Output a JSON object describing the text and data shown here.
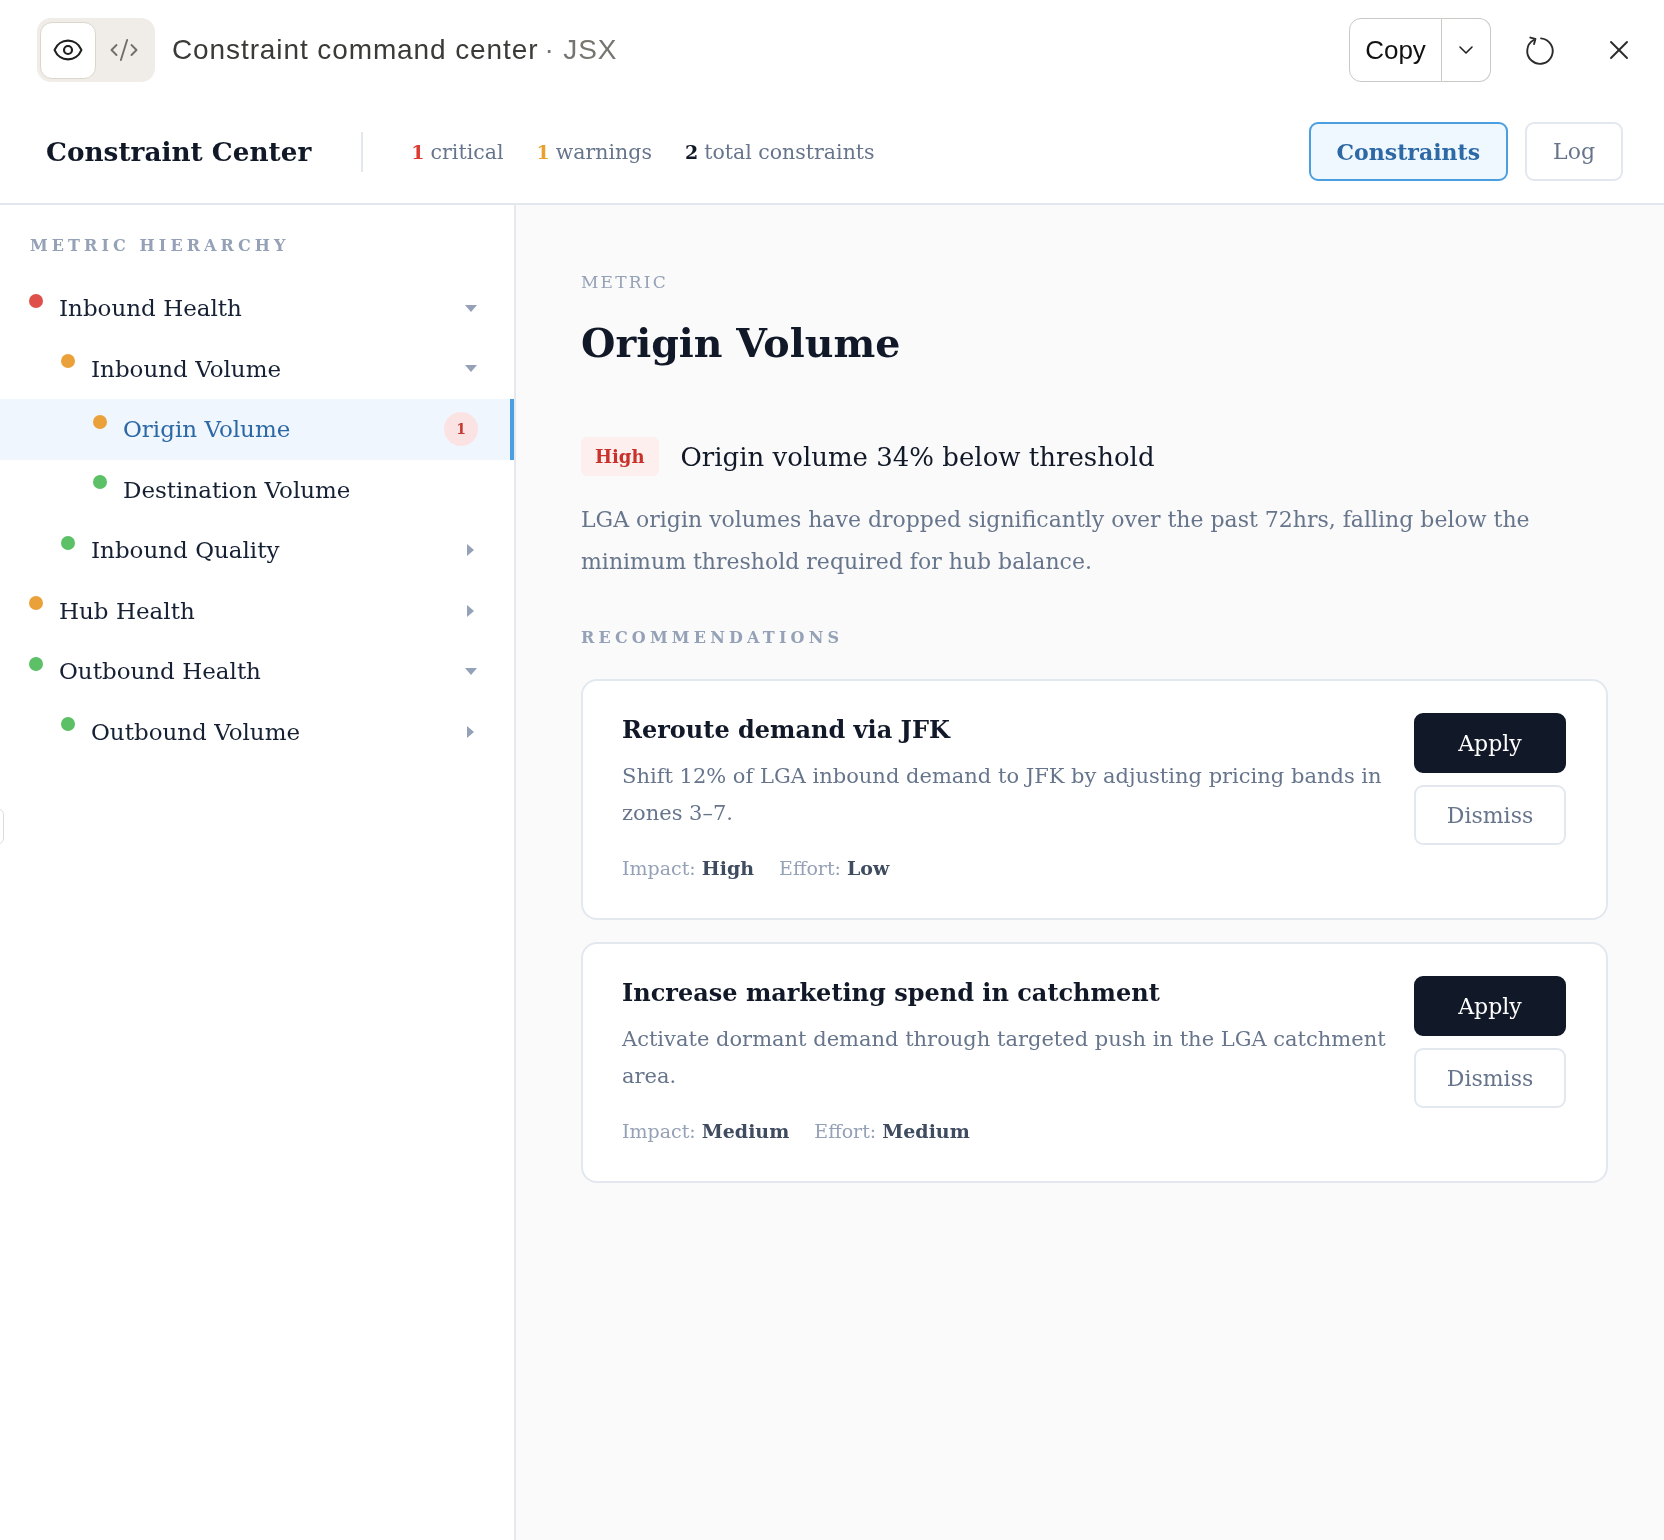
{
  "window": {
    "view_modes": [
      {
        "kind": "preview",
        "selected": true
      },
      {
        "kind": "code",
        "selected": false
      }
    ],
    "title": "Constraint command center",
    "subtitle": "· JSX",
    "copy_button": "Copy"
  },
  "header": {
    "title": "Constraint Center",
    "stats": [
      {
        "count": "1",
        "label": "critical",
        "color": "#dc3b32"
      },
      {
        "count": "1",
        "label": "warnings",
        "color": "#e8a030"
      },
      {
        "count": "2",
        "label": "total constraints",
        "color": "#111827"
      }
    ],
    "tabs": [
      {
        "label": "Constraints",
        "selected": true
      },
      {
        "label": "Log",
        "selected": false
      }
    ]
  },
  "sidebar": {
    "heading": "METRIC HIERARCHY",
    "items": [
      {
        "label": "Inbound Health",
        "color": "#e0504a",
        "expanded": true,
        "selected": false,
        "children": [
          {
            "label": "Inbound Volume",
            "color": "#eba13a",
            "expanded": true,
            "selected": false,
            "children": [
              {
                "label": "Origin Volume",
                "color": "#eba13a",
                "selected": true,
                "badge": "1"
              },
              {
                "label": "Destination Volume",
                "color": "#5cc066",
                "selected": false
              }
            ]
          },
          {
            "label": "Inbound Quality",
            "color": "#5cc066",
            "expanded": false,
            "selected": false
          }
        ]
      },
      {
        "label": "Hub Health",
        "color": "#eba13a",
        "expanded": false,
        "selected": false
      },
      {
        "label": "Outbound Health",
        "color": "#5cc066",
        "expanded": true,
        "selected": false,
        "children": [
          {
            "label": "Outbound Volume",
            "color": "#5cc066",
            "expanded": false,
            "selected": false
          }
        ]
      }
    ]
  },
  "detail": {
    "eyebrow": "METRIC",
    "title": "Origin Volume",
    "alert": {
      "kind": "high",
      "severity": "High",
      "headline": "Origin volume 34% below threshold",
      "description": "LGA origin volumes have dropped significantly over the past 72hrs, falling below the minimum threshold required for hub balance."
    },
    "recommendations_heading": "RECOMMENDATIONS",
    "recommendations": [
      {
        "title": "Reroute demand via JFK",
        "description": "Shift 12% of LGA inbound demand to JFK by adjusting pricing bands in zones 3–7.",
        "meta": [
          "Impact: **High**",
          "Effort: **Low**"
        ],
        "actions": [
          {
            "kind": "primary",
            "label": "Apply"
          },
          {
            "kind": "secondary",
            "label": "Dismiss"
          }
        ]
      },
      {
        "title": "Increase marketing spend in catchment",
        "description": "Activate dormant demand through targeted push in the LGA catchment area.",
        "meta": [
          "Impact: **Medium**",
          "Effort: **Medium**"
        ],
        "actions": [
          {
            "kind": "primary",
            "label": "Apply"
          },
          {
            "kind": "secondary",
            "label": "Dismiss"
          }
        ]
      }
    ]
  }
}
